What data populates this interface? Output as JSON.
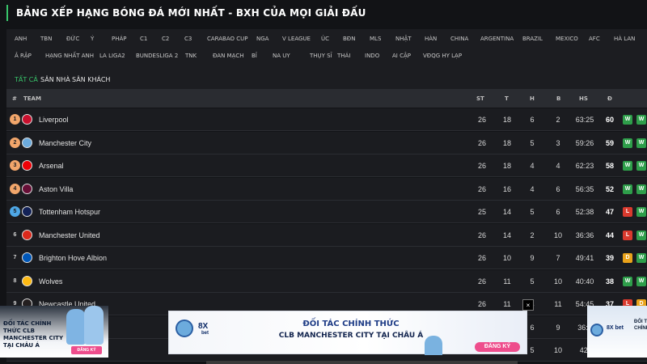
{
  "page": {
    "title": "BẢNG XẾP HẠNG BÓNG ĐÁ MỚI NHẤT - BXH CỦA MỌI GIẢI ĐẤU"
  },
  "leagues_row1": [
    "Anh",
    "TBN",
    "Đức",
    "Ý",
    "Pháp",
    "C1",
    "C2",
    "C3",
    "Carabao Cup",
    "NGA",
    "V League",
    "Úc",
    "BĐN",
    "MLS",
    "Nhật",
    "Hàn",
    "China",
    "Argentina",
    "Brazil",
    "Mexico",
    "AFC",
    "Hà Lan"
  ],
  "leagues_row2": [
    "Ả Rập",
    "Hạng nhất Anh",
    "La Liga2",
    "Bundesliga 2",
    "TNK",
    "Đan Mạch",
    "Bỉ",
    "Na Uy",
    "Thụy Sĩ",
    "Thái",
    "Indo",
    "Ai Cập",
    "VĐQG Hy Lạp"
  ],
  "filters": [
    "Tất cả",
    "Sân nhà",
    "Sân khách"
  ],
  "header": {
    "rank": "#",
    "team": "TEAM",
    "st": "ST",
    "t": "T",
    "h": "H",
    "b": "B",
    "hs": "HS",
    "d": "Đ"
  },
  "colors": {
    "accent_green": "#38c56b",
    "rank_champions": "#f2a66b",
    "rank_europa": "#4ea7e6",
    "form_win": "#2e9e4a",
    "form_loss": "#d93a2e",
    "form_draw": "#e9a21a"
  },
  "teams": [
    {
      "rank": "1",
      "name": "Liverpool",
      "st": "26",
      "t": "18",
      "h": "6",
      "b": "2",
      "hs": "63:25",
      "d": "60",
      "form": [
        "W",
        "W"
      ],
      "crest_color": "#c8102e",
      "zone": "champions"
    },
    {
      "rank": "2",
      "name": "Manchester City",
      "st": "26",
      "t": "18",
      "h": "5",
      "b": "3",
      "hs": "59:26",
      "d": "59",
      "form": [
        "W",
        "W"
      ],
      "crest_color": "#6cabdd",
      "zone": "champions"
    },
    {
      "rank": "3",
      "name": "Arsenal",
      "st": "26",
      "t": "18",
      "h": "4",
      "b": "4",
      "hs": "62:23",
      "d": "58",
      "form": [
        "W",
        "W"
      ],
      "crest_color": "#ef0107",
      "zone": "champions"
    },
    {
      "rank": "4",
      "name": "Aston Villa",
      "st": "26",
      "t": "16",
      "h": "4",
      "b": "6",
      "hs": "56:35",
      "d": "52",
      "form": [
        "W",
        "W"
      ],
      "crest_color": "#670e36",
      "zone": "champions"
    },
    {
      "rank": "5",
      "name": "Tottenham Hotspur",
      "st": "25",
      "t": "14",
      "h": "5",
      "b": "6",
      "hs": "52:38",
      "d": "47",
      "form": [
        "L",
        "W"
      ],
      "crest_color": "#132257",
      "zone": "europa"
    },
    {
      "rank": "6",
      "name": "Manchester United",
      "st": "26",
      "t": "14",
      "h": "2",
      "b": "10",
      "hs": "36:36",
      "d": "44",
      "form": [
        "L",
        "W"
      ],
      "crest_color": "#da291c",
      "zone": ""
    },
    {
      "rank": "7",
      "name": "Brighton Hove Albion",
      "st": "26",
      "t": "10",
      "h": "9",
      "b": "7",
      "hs": "49:41",
      "d": "39",
      "form": [
        "D",
        "W"
      ],
      "crest_color": "#0057b8",
      "zone": ""
    },
    {
      "rank": "8",
      "name": "Wolves",
      "st": "26",
      "t": "11",
      "h": "5",
      "b": "10",
      "hs": "40:40",
      "d": "38",
      "form": [
        "W",
        "W"
      ],
      "crest_color": "#fdb913",
      "zone": ""
    },
    {
      "rank": "9",
      "name": "Newcastle United",
      "st": "26",
      "t": "11",
      "h": "4",
      "b": "11",
      "hs": "54:45",
      "d": "37",
      "form": [
        "L",
        "D"
      ],
      "crest_color": "#241f20",
      "zone": ""
    }
  ],
  "partial_rows": [
    {
      "h": "6",
      "b": "9",
      "hs": "36:4"
    },
    {
      "h": "5",
      "b": "10",
      "hs": "42:"
    }
  ],
  "ads": {
    "left_text": "ĐỐI TÁC CHÍNH THỨC CLB MANCHESTER CITY TẠI CHÂU Á",
    "left_btn": "ĐĂNG KÝ",
    "center_brand": "8X",
    "center_brand2": "bet",
    "center_headline": "ĐỐI TÁC CHÍNH THỨC",
    "center_subline": "CLB MANCHESTER CITY TẠI CHÂU Á",
    "center_btn": "ĐĂNG KÝ",
    "close": "×",
    "right_brand": "8X bet",
    "right_text": "ĐỐI TÁC CHÍNH THỨC"
  }
}
